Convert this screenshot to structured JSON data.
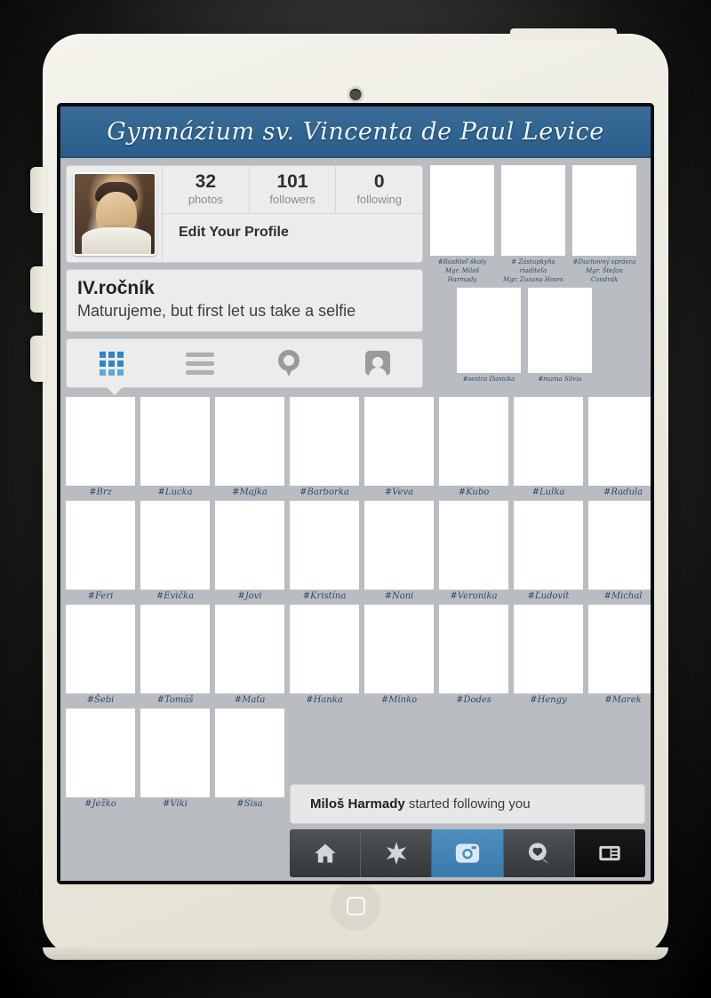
{
  "app": {
    "title": "Gymnázium sv. Vincenta de Paul Levice"
  },
  "profile": {
    "avatar_name": "saint-vincent-portrait",
    "stats": [
      {
        "num": "32",
        "label": "photos"
      },
      {
        "num": "101",
        "label": "followers"
      },
      {
        "num": "0",
        "label": "following"
      }
    ],
    "edit_label": "Edit Your Profile",
    "bio_name": "IV.ročník",
    "bio_text": "Maturujeme, but first let us take a selfie"
  },
  "tabs": [
    {
      "icon": "grid-icon",
      "label": "grid",
      "active": true
    },
    {
      "icon": "list-icon",
      "label": "list",
      "active": false
    },
    {
      "icon": "map-pin-icon",
      "label": "map",
      "active": false
    },
    {
      "icon": "tagged-photos-icon",
      "label": "tagged",
      "active": false
    }
  ],
  "teachers": {
    "row1": [
      {
        "line1": "#Riaditeľ školy",
        "line2": "Mgr. Miloš Harmady"
      },
      {
        "line1": "# Zástupkyňa riaditeľa",
        "line2": "Mgr. Zuzana Hosrs"
      },
      {
        "line1": "#Duchovný správca",
        "line2": "Mgr. Štefan Candrák"
      }
    ],
    "row2": [
      {
        "line1": "#sestra Danicka",
        "line2": ""
      },
      {
        "line1": "#mama Silvia",
        "line2": ""
      }
    ]
  },
  "photo_grid": {
    "rows": [
      [
        "#Brz",
        "#Lucka",
        "#Majka",
        "#Barborka",
        "#Veva",
        "#Kubo",
        "#Lulka",
        "#Radula"
      ],
      [
        "#Feri",
        "#Evička",
        "#Jovi",
        "#Kristína",
        "#Noni",
        "#Veronika",
        "#Ľudovít",
        "#Michal"
      ],
      [
        "#Šebi",
        "#Tomáš",
        "#Maťa",
        "#Hanka",
        "#Minko",
        "#Dodes",
        "#Hengy",
        "#Marek"
      ],
      [
        "#Ježko",
        "#Viki",
        "#Sisa"
      ]
    ]
  },
  "notification": {
    "user": "Miloš Harmady",
    "text": " started following you"
  },
  "navbar": [
    {
      "icon": "home-icon",
      "label": "home",
      "state": "normal"
    },
    {
      "icon": "explore-compass-icon",
      "label": "explore",
      "state": "normal"
    },
    {
      "icon": "camera-icon",
      "label": "camera",
      "state": "active"
    },
    {
      "icon": "heart-search-icon",
      "label": "activity",
      "state": "normal"
    },
    {
      "icon": "news-feed-icon",
      "label": "news",
      "state": "dark"
    }
  ],
  "device": {
    "camera": "front-camera",
    "speaker": "earpiece-speaker",
    "home": "home-button"
  },
  "colors": {
    "header_blue": "#2f6491",
    "accent_blue": "#2f86c8",
    "caption_ink": "#31496b",
    "app_bg": "#b9bdc1"
  }
}
